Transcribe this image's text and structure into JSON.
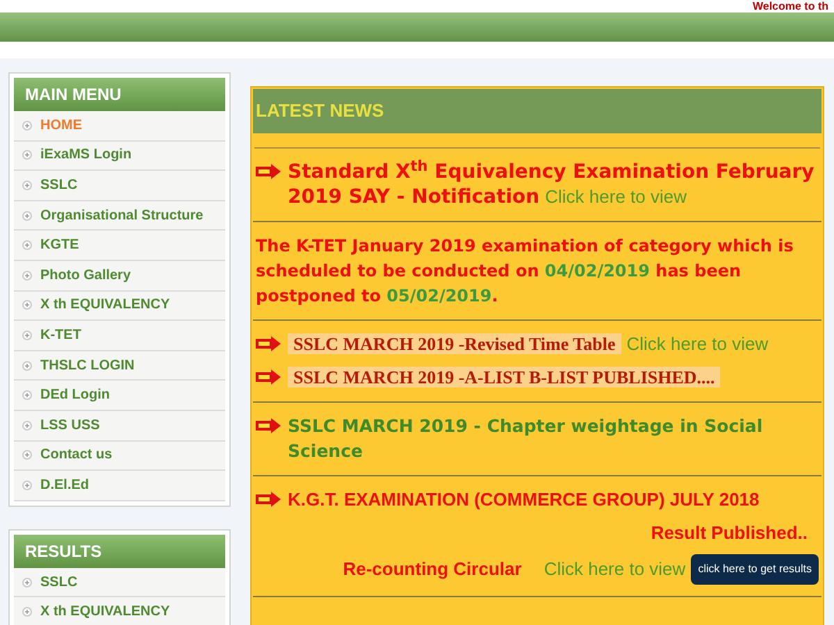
{
  "header": {
    "welcome": "Welcome to th"
  },
  "main_menu": {
    "title": "MAIN MENU",
    "items": [
      {
        "label": "HOME",
        "selected": true
      },
      {
        "label": "iExaMS Login",
        "selected": false
      },
      {
        "label": "SSLC",
        "selected": false
      },
      {
        "label": "Organisational Structure",
        "selected": false
      },
      {
        "label": "KGTE",
        "selected": false
      },
      {
        "label": "Photo Gallery",
        "selected": false
      },
      {
        "label": "X th EQUIVALENCY",
        "selected": false
      },
      {
        "label": "K-TET",
        "selected": false
      },
      {
        "label": "THSLC LOGIN",
        "selected": false
      },
      {
        "label": "DEd Login",
        "selected": false
      },
      {
        "label": "LSS USS",
        "selected": false
      },
      {
        "label": "Contact us",
        "selected": false
      },
      {
        "label": "D.El.Ed",
        "selected": false
      }
    ]
  },
  "results_menu": {
    "title": "RESULTS",
    "items": [
      {
        "label": "SSLC",
        "selected": false
      },
      {
        "label": "X th EQUIVALENCY",
        "selected": false
      }
    ]
  },
  "latest_news": {
    "title": "LATEST NEWS",
    "blocks": [
      {
        "lines": [
          {
            "kind": "item",
            "new": true,
            "segments": [
              {
                "kind": "headline",
                "text": "Standard  X$^{th}$ Equivalency Examination February 2019 SAY - Notification"
              },
              {
                "kind": "link",
                "text": "Click here to view"
              }
            ]
          }
        ]
      },
      {
        "lines": [
          {
            "kind": "item",
            "new": false,
            "segments": [
              {
                "kind": "notice",
                "text": "The K-TET January 2019 examination of category which is scheduled to be conducted on "
              },
              {
                "kind": "date",
                "text": "04/02/2019"
              },
              {
                "kind": "notice",
                "text": " has been postponed to "
              },
              {
                "kind": "date",
                "text": "05/02/2019"
              },
              {
                "kind": "notice",
                "text": "."
              }
            ]
          }
        ]
      },
      {
        "lines": [
          {
            "kind": "item",
            "new": true,
            "segments": [
              {
                "kind": "serif",
                "text": "SSLC MARCH 2019 -Revised Time Table"
              },
              {
                "kind": "link",
                "text": "Click here to view"
              }
            ]
          },
          {
            "kind": "item",
            "new": true,
            "segments": [
              {
                "kind": "serif",
                "text": "SSLC MARCH 2019 -A-LIST B-LIST PUBLISHED...."
              }
            ]
          }
        ]
      },
      {
        "lines": [
          {
            "kind": "item",
            "new": true,
            "segments": [
              {
                "kind": "green",
                "text": "SSLC MARCH 2019 - Chapter weightage in Social Science"
              }
            ]
          }
        ]
      },
      {
        "lines": [
          {
            "kind": "item",
            "new": true,
            "segments": [
              {
                "kind": "arial",
                "text": "K.G.T. EXAMINATION (COMMERCE GROUP) JULY 2018"
              }
            ]
          },
          {
            "kind": "note",
            "new": false,
            "segments": [
              {
                "kind": "arial",
                "text": "Result Published.."
              }
            ]
          },
          {
            "kind": "note",
            "new": false,
            "segments": [
              {
                "kind": "arial",
                "text": "Re-counting Circular"
              },
              {
                "kind": "link",
                "text": "Click here to view"
              },
              {
                "kind": "button",
                "text": "click here to get results"
              }
            ]
          }
        ]
      }
    ]
  }
}
